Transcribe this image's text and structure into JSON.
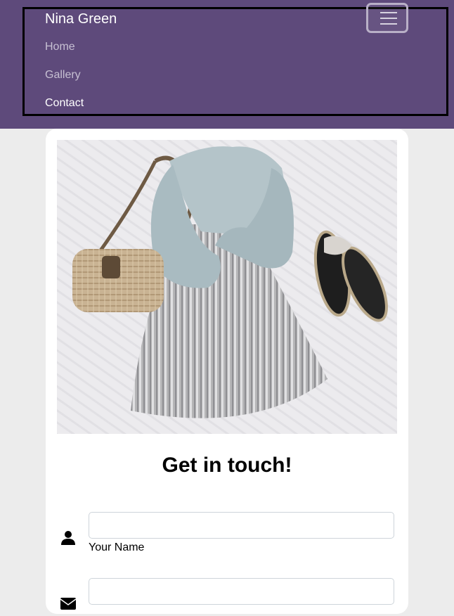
{
  "navbar": {
    "brand": "Nina Green",
    "toggle_icon": "hamburger-menu-icon",
    "links": [
      {
        "label": "Home",
        "active": false
      },
      {
        "label": "Gallery",
        "active": false
      },
      {
        "label": "Contact",
        "active": true
      }
    ],
    "background": "#5e4a7b"
  },
  "hero": {
    "image": "outfit-flatlay-photo"
  },
  "contact": {
    "heading": "Get in touch!",
    "fields": [
      {
        "icon": "user-icon",
        "label": "Your Name",
        "value": ""
      },
      {
        "icon": "envelope-icon",
        "label": "",
        "value": ""
      }
    ]
  }
}
